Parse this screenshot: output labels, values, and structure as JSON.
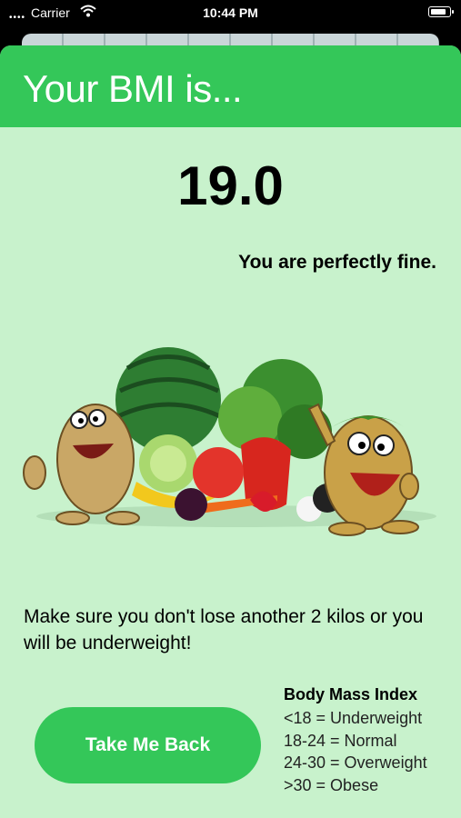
{
  "status_bar": {
    "carrier": "Carrier",
    "time": "10:44 PM"
  },
  "header": {
    "title": "Your BMI is..."
  },
  "result": {
    "bmi": "19.0",
    "advice_title": "You are perfectly fine.",
    "advice": "Make sure you don't lose another 2 kilos or you will be underweight!"
  },
  "actions": {
    "back_label": "Take Me Back"
  },
  "legend": {
    "title": "Body Mass Index",
    "rows": [
      "<18 = Underweight",
      "18-24 = Normal",
      "24-30 = Overweight",
      ">30 = Obese"
    ]
  },
  "colors": {
    "accent": "#34c759",
    "background": "#c8f2cc"
  },
  "illustration": "cartoon-potatoes-with-vegetables"
}
